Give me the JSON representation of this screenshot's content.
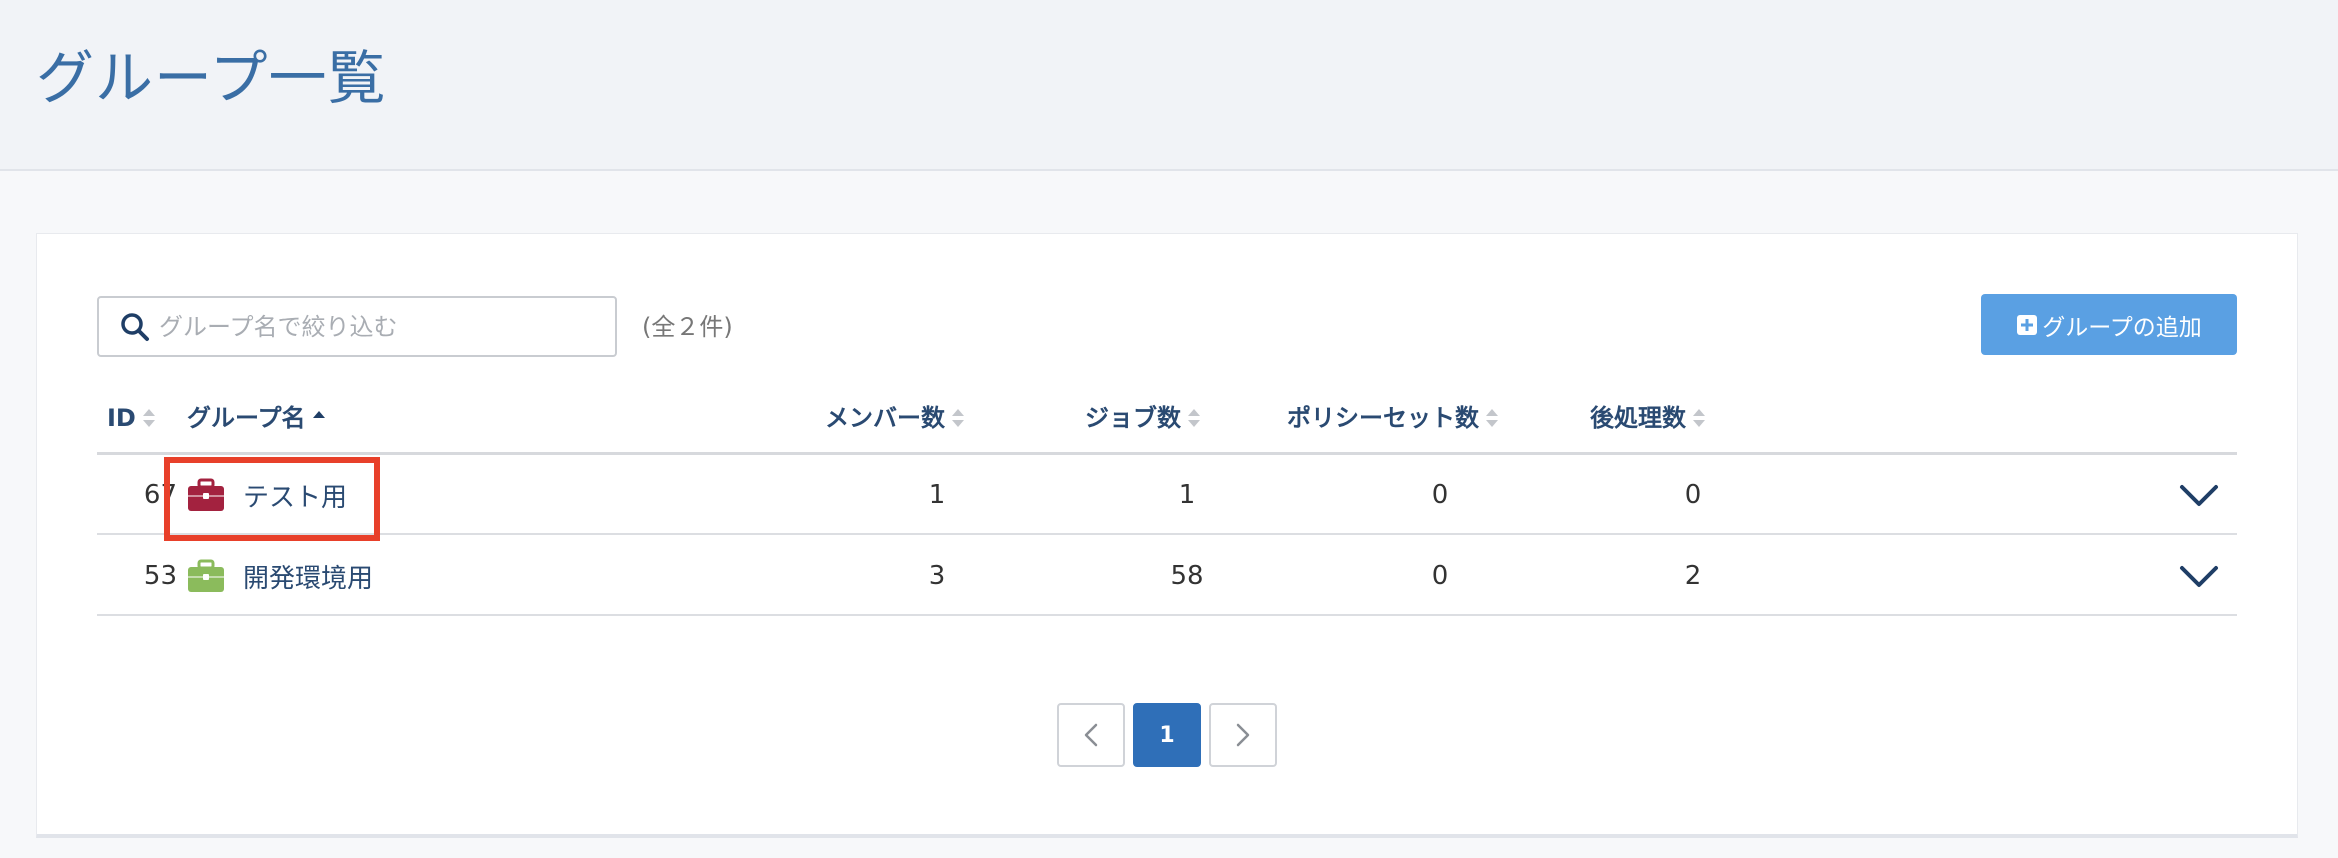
{
  "page": {
    "title": "グループ一覧"
  },
  "toolbar": {
    "search_placeholder": "グループ名で絞り込む",
    "search_value": "",
    "count_text": "(全２件)",
    "add_button_label": "グループの追加"
  },
  "table": {
    "columns": [
      "ID",
      "グループ名",
      "メンバー数",
      "ジョブ数",
      "ポリシーセット数",
      "後処理数"
    ],
    "sorted_column": "グループ名",
    "sort_direction": "asc",
    "rows": [
      {
        "id": "67",
        "name": "テスト用",
        "icon_color": "#a3223f",
        "members": "1",
        "jobs": "1",
        "policy_sets": "0",
        "post_processes": "0"
      },
      {
        "id": "53",
        "name": "開発環境用",
        "icon_color": "#8bbb5c",
        "members": "3",
        "jobs": "58",
        "policy_sets": "0",
        "post_processes": "2"
      }
    ]
  },
  "pagination": {
    "current_page": "1"
  },
  "colors": {
    "title": "#3a6ea5",
    "accent_button": "#5aa0e3",
    "active_page": "#2f6fb8",
    "header_text": "#2a4a72",
    "highlight": "#e8402a"
  },
  "icons": {
    "search": "search-icon",
    "add": "plus-square-icon",
    "group": "briefcase-icon",
    "expand": "chevron-down-icon",
    "prev": "chevron-left-icon",
    "next": "chevron-right-icon",
    "sort": "sort-icon"
  }
}
